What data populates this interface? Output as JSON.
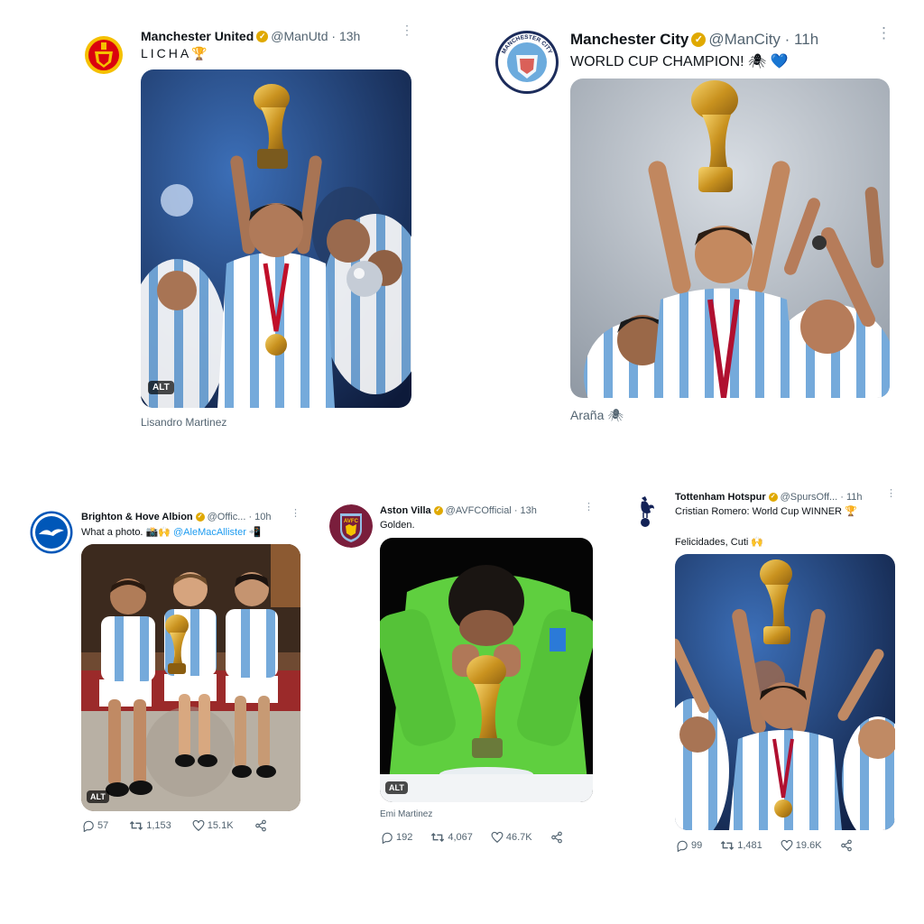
{
  "tweets": [
    {
      "account": "Manchester United",
      "handle": "@ManUtd",
      "time": "13h",
      "text": "LICHA🏆",
      "caption": "Lisandro Martinez",
      "alt_badge": "ALT",
      "avatar_icon": "man-utd-crest-icon"
    },
    {
      "account": "Manchester City",
      "handle": "@ManCity",
      "time": "11h",
      "text": "WORLD CUP CHAMPION! 🕷 💙",
      "caption": "Araña 🕷",
      "avatar_icon": "man-city-crest-icon",
      "crest_text": "MANCHESTER CITY"
    },
    {
      "account": "Brighton & Hove Albion",
      "handle": "@Offic...",
      "time": "10h",
      "text": "What a photo. 📸🙌",
      "mention": "@AleMacAllister",
      "mention_emoji": "📲",
      "alt_badge": "ALT",
      "avatar_icon": "brighton-seagull-crest-icon",
      "actions": {
        "replies": "57",
        "retweets": "1,153",
        "likes": "15.1K"
      }
    },
    {
      "account": "Aston Villa",
      "handle": "@AVFCOfficial",
      "time": "13h",
      "text": "Golden.",
      "caption": "Emi Martinez",
      "alt_badge": "ALT",
      "avatar_icon": "aston-villa-crest-icon",
      "crest_text": "AVFC",
      "actions": {
        "replies": "192",
        "retweets": "4,067",
        "likes": "46.7K"
      }
    },
    {
      "account": "Tottenham Hotspur",
      "handle": "@SpursOff...",
      "time": "11h",
      "text": "Cristian Romero: World Cup WINNER 🏆",
      "text2": "Felicidades, Cuti 🙌",
      "avatar_icon": "spurs-cockerel-icon",
      "actions": {
        "replies": "99",
        "retweets": "1,481",
        "likes": "19.6K"
      }
    }
  ],
  "colors": {
    "verified": "#e0a900",
    "link": "#1d9bf0",
    "argentina_blue": "#75aadb",
    "keeper_green": "#5fcf3f",
    "trophy_gold": "#d4a52a"
  }
}
